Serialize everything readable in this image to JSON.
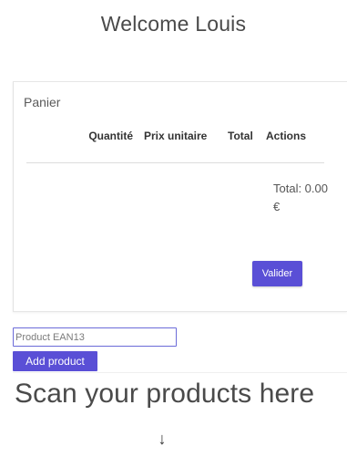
{
  "header": {
    "welcome": "Welcome Louis"
  },
  "cart": {
    "title": "Panier",
    "columns": [
      "",
      "Quantité",
      "Prix unitaire",
      "Total",
      "Actions"
    ],
    "rows": [],
    "total_label": "Total: 0.00 €",
    "validate_label": "Valider"
  },
  "scanner": {
    "input_placeholder": "Product EAN13",
    "input_value": "",
    "add_label": "Add product",
    "instruction": "Scan your products here",
    "arrow": "↓"
  },
  "colors": {
    "accent": "#5a4fd6",
    "input_border": "#6b6bd8"
  }
}
